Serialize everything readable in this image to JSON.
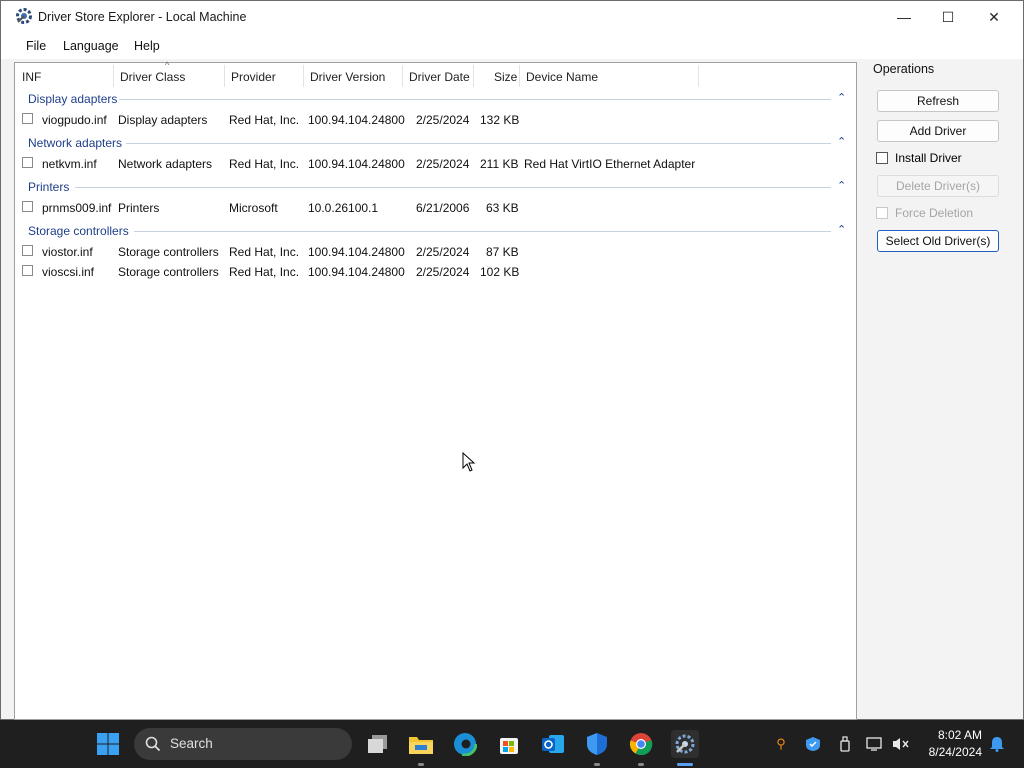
{
  "window": {
    "title": "Driver Store Explorer - Local Machine",
    "controls": {
      "minimize": "—",
      "maximize": "☐",
      "close": "✕"
    }
  },
  "menu": [
    "File",
    "Language",
    "Help"
  ],
  "table": {
    "columns": [
      "INF",
      "Driver Class",
      "Provider",
      "Driver Version",
      "Driver Date",
      "Size",
      "Device Name"
    ],
    "sort_indicator": "^",
    "groups": [
      {
        "name": "Display adapters",
        "rows": [
          {
            "inf": "viogpudo.inf",
            "class": "Display adapters",
            "provider": "Red Hat, Inc.",
            "version": "100.94.104.24800",
            "date": "2/25/2024",
            "size": "132 KB",
            "device": ""
          }
        ]
      },
      {
        "name": "Network adapters",
        "rows": [
          {
            "inf": "netkvm.inf",
            "class": "Network adapters",
            "provider": "Red Hat, Inc.",
            "version": "100.94.104.24800",
            "date": "2/25/2024",
            "size": "211 KB",
            "device": "Red Hat VirtIO Ethernet Adapter"
          }
        ]
      },
      {
        "name": "Printers",
        "rows": [
          {
            "inf": "prnms009.inf",
            "class": "Printers",
            "provider": "Microsoft",
            "version": "10.0.26100.1",
            "date": "6/21/2006",
            "size": "63 KB",
            "device": ""
          }
        ]
      },
      {
        "name": "Storage controllers",
        "rows": [
          {
            "inf": "viostor.inf",
            "class": "Storage controllers",
            "provider": "Red Hat, Inc.",
            "version": "100.94.104.24800",
            "date": "2/25/2024",
            "size": "87 KB",
            "device": ""
          },
          {
            "inf": "vioscsi.inf",
            "class": "Storage controllers",
            "provider": "Red Hat, Inc.",
            "version": "100.94.104.24800",
            "date": "2/25/2024",
            "size": "102 KB",
            "device": ""
          }
        ]
      }
    ]
  },
  "operations": {
    "title": "Operations",
    "refresh": "Refresh",
    "add_driver": "Add Driver",
    "install_driver": "Install Driver",
    "delete_driver": "Delete Driver(s)",
    "force_deletion": "Force Deletion",
    "select_old": "Select Old Driver(s)"
  },
  "taskbar": {
    "search": "Search",
    "time": "8:02 AM",
    "date": "8/24/2024"
  },
  "colors": {
    "group_text": "#1e3f8a",
    "taskbar": "#1f1f1f",
    "accent": "#1f5fbf"
  }
}
